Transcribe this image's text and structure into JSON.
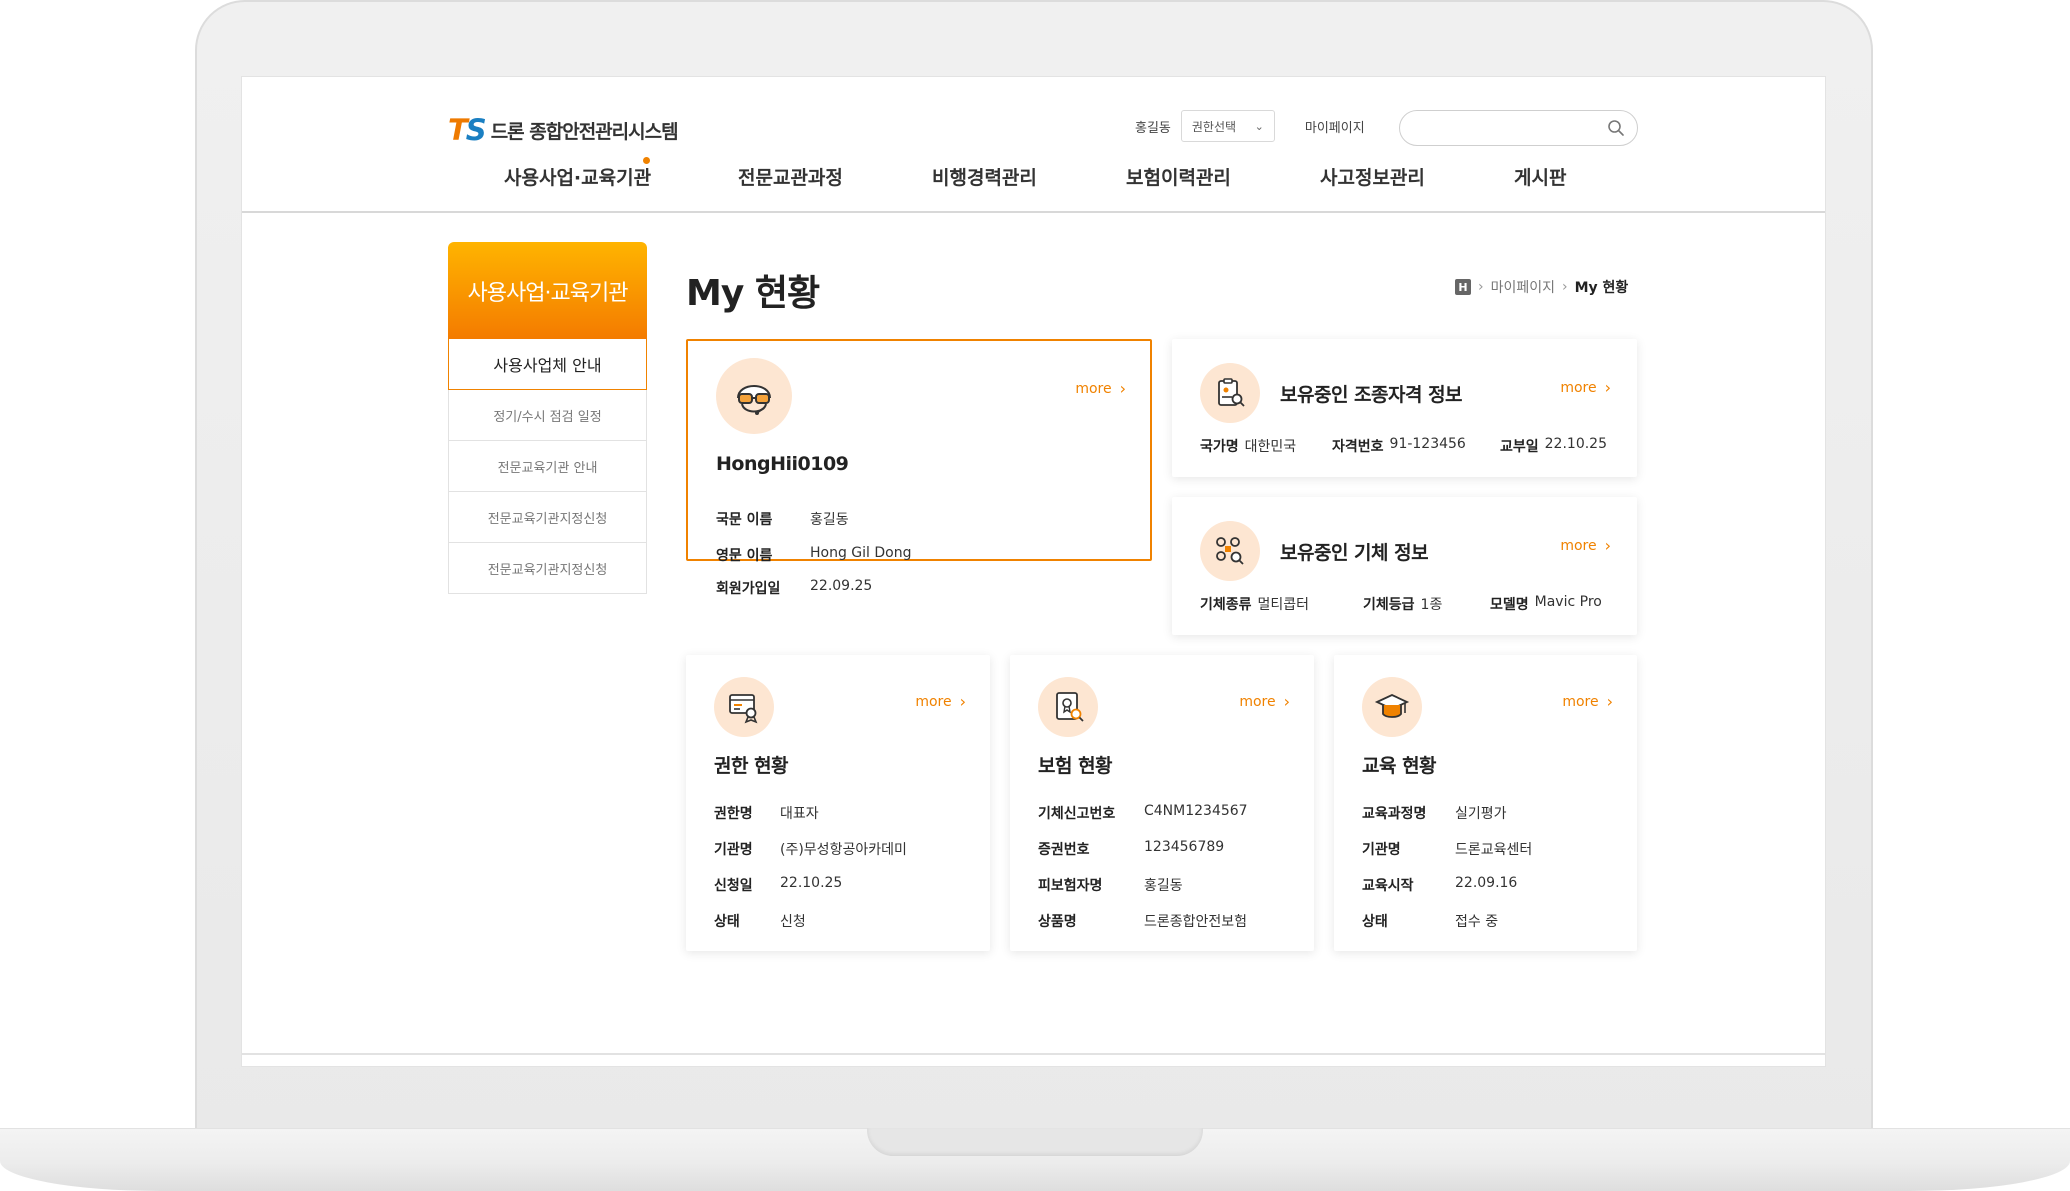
{
  "header": {
    "logo_mark_t": "T",
    "logo_mark_s": "S",
    "logo_text": "드론 종합안전관리시스템",
    "user_name": "홍길동",
    "role_select": "권한선택",
    "mypage": "마이페이지",
    "search_placeholder": ""
  },
  "gnb": [
    "사용사업·교육기관",
    "전문교관과정",
    "비행경력관리",
    "보험이력관리",
    "사고정보관리",
    "게시판"
  ],
  "lnb": {
    "title": "사용사업·교육기관",
    "items": [
      "사용사업체 안내",
      "정기/수시 점검 일정",
      "전문교육기관 안내",
      "전문교육기관지정신청",
      "전문교육기관지정신청"
    ]
  },
  "page": {
    "title": "My 현황",
    "breadcrumb": [
      "H",
      "마이페이지",
      "My 현황"
    ]
  },
  "more_label": "more",
  "profile_card": {
    "user_id": "HongHii0109",
    "rows": [
      {
        "k": "국문 이름",
        "v": "홍길동"
      },
      {
        "k": "영문 이름",
        "v": "Hong Gil Dong"
      },
      {
        "k": "회원가입일",
        "v": "22.09.25"
      }
    ]
  },
  "license_card": {
    "title": "보유중인 조종자격 정보",
    "items": [
      {
        "k": "국가명",
        "v": "대한민국"
      },
      {
        "k": "자격번호",
        "v": "91-123456"
      },
      {
        "k": "교부일",
        "v": "22.10.25"
      }
    ]
  },
  "drone_card": {
    "title": "보유중인 기체 정보",
    "items": [
      {
        "k": "기체종류",
        "v": "멀티콥터"
      },
      {
        "k": "기체등급",
        "v": "1종"
      },
      {
        "k": "모델명",
        "v": "Mavic Pro"
      }
    ]
  },
  "authority_card": {
    "title": "권한 현황",
    "rows": [
      {
        "k": "권한명",
        "v": "대표자"
      },
      {
        "k": "기관명",
        "v": "(주)무성항공아카데미"
      },
      {
        "k": "신청일",
        "v": "22.10.25"
      },
      {
        "k": "상태",
        "v": "신청"
      }
    ]
  },
  "insurance_card": {
    "title": "보험 현황",
    "rows": [
      {
        "k": "기체신고번호",
        "v": "C4NM1234567"
      },
      {
        "k": "증권번호",
        "v": "123456789"
      },
      {
        "k": "피보험자명",
        "v": "홍길동"
      },
      {
        "k": "상품명",
        "v": "드론종합안전보험"
      }
    ]
  },
  "education_card": {
    "title": "교육 현황",
    "rows": [
      {
        "k": "교육과정명",
        "v": "실기평가"
      },
      {
        "k": "기관명",
        "v": "드론교육센터"
      },
      {
        "k": "교육시작",
        "v": "22.09.16"
      },
      {
        "k": "상태",
        "v": "접수 중"
      }
    ]
  },
  "colors": {
    "accent": "#f08200",
    "accent_light": "#fde6d2",
    "logo_blue": "#1a7fc2"
  }
}
